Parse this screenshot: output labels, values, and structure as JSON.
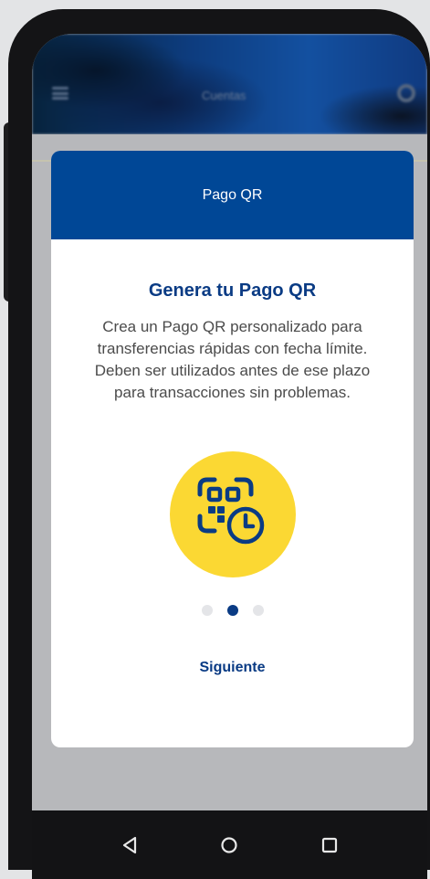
{
  "app": {
    "header_title": "Cuentas",
    "icons": [
      "menu-icon",
      "settings-icon"
    ]
  },
  "modal": {
    "header_title": "Pago QR",
    "title": "Genera tu Pago QR",
    "description": "Crea un Pago QR personalizado para transferencias rápidas con fecha límite. Deben ser utilizados antes de ese plazo para transacciones sin problemas.",
    "illustration_icon": "qr-clock-icon",
    "pagination": {
      "total": 3,
      "active_index": 1
    },
    "next_label": "Siguiente"
  },
  "colors": {
    "brand_blue": "#004796",
    "title_blue": "#0a3b84",
    "accent_yellow": "#fbd833"
  },
  "system_nav": [
    "back-icon",
    "home-icon",
    "recents-icon"
  ]
}
